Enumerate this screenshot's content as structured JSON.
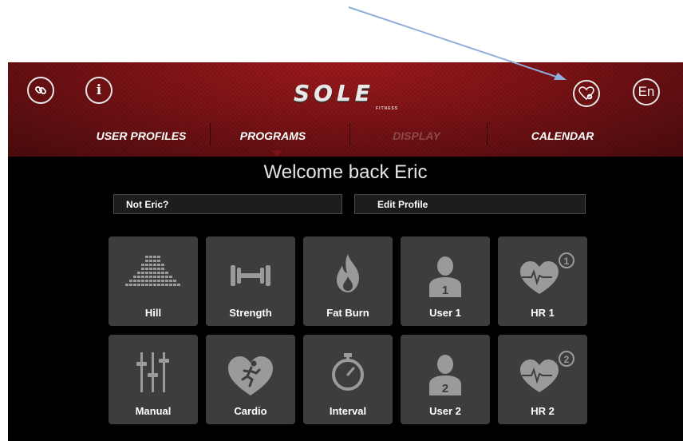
{
  "header": {
    "left_icons": [
      "link-icon",
      "info-icon"
    ],
    "info_glyph": "i",
    "logo": {
      "word": "SOLE",
      "sub": "FITNESS"
    },
    "right_icons": [
      "heart-rate-icon"
    ],
    "language_label": "En"
  },
  "nav": {
    "tabs": [
      {
        "label": "USER PROFILES",
        "state": "normal"
      },
      {
        "label": "PROGRAMS",
        "state": "selected"
      },
      {
        "label": "DISPLAY",
        "state": "disabled"
      },
      {
        "label": "CALENDAR",
        "state": "normal"
      }
    ]
  },
  "welcome_text": "Welcome back Eric",
  "actions": {
    "not_user_label": "Not Eric?",
    "edit_profile_label": "Edit Profile"
  },
  "programs": [
    {
      "label": "Hill",
      "icon": "hill-bars-icon"
    },
    {
      "label": "Strength",
      "icon": "dumbbell-icon"
    },
    {
      "label": "Fat Burn",
      "icon": "flame-icon"
    },
    {
      "label": "User 1",
      "icon": "user-icon",
      "badge": "1"
    },
    {
      "label": "HR 1",
      "icon": "heart-rate-icon",
      "badge": "1"
    },
    {
      "label": "Manual",
      "icon": "sliders-icon"
    },
    {
      "label": "Cardio",
      "icon": "runner-heart-icon"
    },
    {
      "label": "Interval",
      "icon": "stopwatch-icon"
    },
    {
      "label": "User 2",
      "icon": "user-icon",
      "badge": "2"
    },
    {
      "label": "HR 2",
      "icon": "heart-rate-icon",
      "badge": "2"
    }
  ],
  "colors": {
    "header_red": "#7d1316",
    "tile_gray": "#3d3d3d",
    "icon_gray": "#9a9a9a",
    "annotation_arrow": "#8eaedb"
  }
}
